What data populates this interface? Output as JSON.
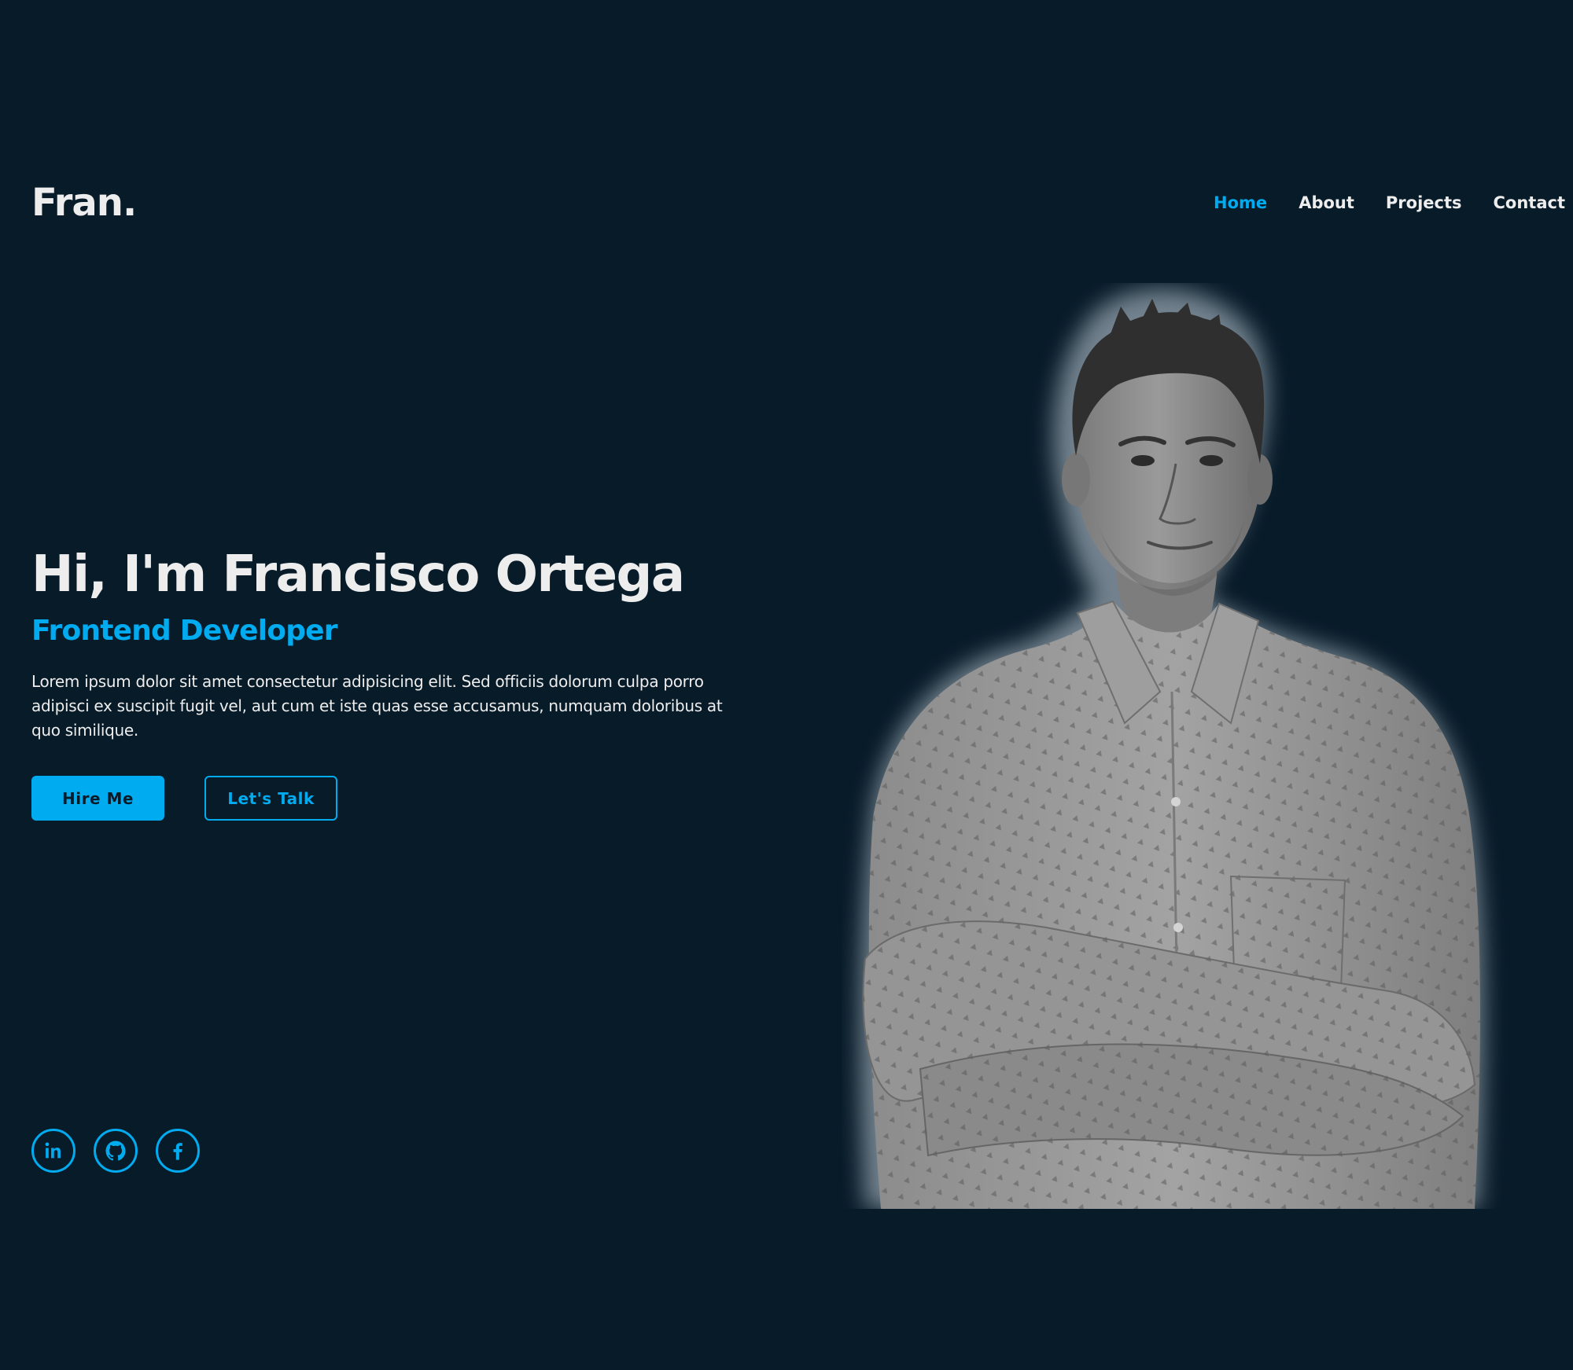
{
  "header": {
    "logo": "Fran.",
    "nav": [
      {
        "label": "Home",
        "active": true
      },
      {
        "label": "About",
        "active": false
      },
      {
        "label": "Projects",
        "active": false
      },
      {
        "label": "Contact",
        "active": false
      }
    ]
  },
  "hero": {
    "title": "Hi, I'm Francisco Ortega",
    "subtitle": "Frontend Developer",
    "description": "Lorem ipsum dolor sit amet consectetur adipisicing elit. Sed officiis dolorum culpa porro adipisci ex suscipit fugit vel, aut cum et iste quas esse accusamus, numquam doloribus at quo similique.",
    "buttons": {
      "primary": "Hire Me",
      "secondary": "Let's Talk"
    }
  },
  "social": [
    {
      "name": "linkedin",
      "icon": "linkedin-icon"
    },
    {
      "name": "github",
      "icon": "github-icon"
    },
    {
      "name": "facebook",
      "icon": "facebook-icon"
    }
  ],
  "colors": {
    "background": "#081b29",
    "accent": "#00abf0",
    "text": "#ededed"
  }
}
